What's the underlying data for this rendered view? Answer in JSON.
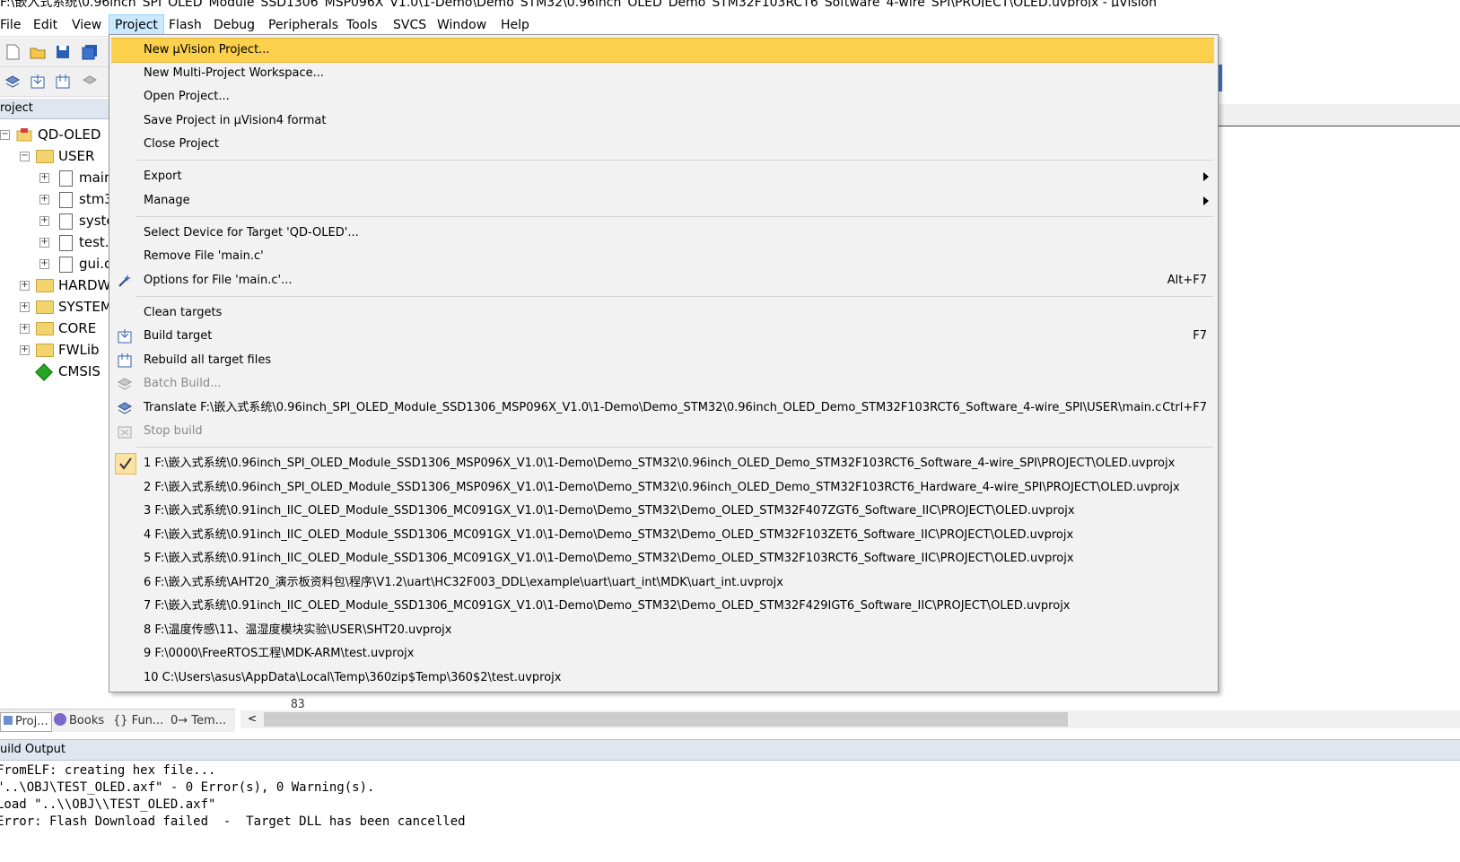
{
  "title": "F:\\嵌入式系统\\0.96inch_SPI_OLED_Module_SSD1306_MSP096X_V1.0\\1-Demo\\Demo_STM32\\0.96inch_OLED_Demo_STM32F103RCT6_Software_4-wire_SPI\\PROJECT\\OLED.uvprojx - µVision",
  "menu": [
    "File",
    "Edit",
    "View",
    "Project",
    "Flash",
    "Debug",
    "Peripherals",
    "Tools",
    "SVCS",
    "Window",
    "Help"
  ],
  "project_pane": {
    "header": "roject",
    "root": "QD-OLED",
    "group_user": "USER",
    "user_files": [
      "main",
      "stm3",
      "syste",
      "test.c",
      "gui.c"
    ],
    "groups": [
      "HARDW",
      "SYSTEM",
      "CORE",
      "FWLib",
      "CMSIS"
    ]
  },
  "dropdown": {
    "new_project": "New µVision Project...",
    "new_workspace": "New Multi-Project Workspace...",
    "open_project": "Open Project...",
    "save_project": "Save Project in µVision4 format",
    "close_project": "Close Project",
    "export": "Export",
    "manage": "Manage",
    "select_device": "Select Device for Target 'QD-OLED'...",
    "remove_file": "Remove File 'main.c'",
    "options_file": "Options for File 'main.c'...",
    "options_shortcut": "Alt+F7",
    "clean_targets": "Clean targets",
    "build_target": "Build target",
    "build_shortcut": "F7",
    "rebuild_all": "Rebuild all target files",
    "batch_build": "Batch Build...",
    "translate": "Translate F:\\嵌入式系统\\0.96inch_SPI_OLED_Module_SSD1306_MSP096X_V1.0\\1-Demo\\Demo_STM32\\0.96inch_OLED_Demo_STM32F103RCT6_Software_4-wire_SPI\\USER\\main.c",
    "translate_shortcut": "Ctrl+F7",
    "stop_build": "Stop build",
    "recent": [
      "1 F:\\嵌入式系统\\0.96inch_SPI_OLED_Module_SSD1306_MSP096X_V1.0\\1-Demo\\Demo_STM32\\0.96inch_OLED_Demo_STM32F103RCT6_Software_4-wire_SPI\\PROJECT\\OLED.uvprojx",
      "2 F:\\嵌入式系统\\0.96inch_SPI_OLED_Module_SSD1306_MSP096X_V1.0\\1-Demo\\Demo_STM32\\0.96inch_OLED_Demo_STM32F103RCT6_Hardware_4-wire_SPI\\PROJECT\\OLED.uvprojx",
      "3 F:\\嵌入式系统\\0.91inch_IIC_OLED_Module_SSD1306_MC091GX_V1.0\\1-Demo\\Demo_STM32\\Demo_OLED_STM32F407ZGT6_Software_IIC\\PROJECT\\OLED.uvprojx",
      "4 F:\\嵌入式系统\\0.91inch_IIC_OLED_Module_SSD1306_MC091GX_V1.0\\1-Demo\\Demo_STM32\\Demo_OLED_STM32F103ZET6_Software_IIC\\PROJECT\\OLED.uvprojx",
      "5 F:\\嵌入式系统\\0.91inch_IIC_OLED_Module_SSD1306_MC091GX_V1.0\\1-Demo\\Demo_STM32\\Demo_OLED_STM32F103RCT6_Software_IIC\\PROJECT\\OLED.uvprojx",
      "6 F:\\嵌入式系统\\AHT20_演示板资料包\\程序\\V1.2\\uart\\HC32F003_DDL\\example\\uart\\uart_int\\MDK\\uart_int.uvprojx",
      "7 F:\\嵌入式系统\\0.91inch_IIC_OLED_Module_SSD1306_MC091GX_V1.0\\1-Demo\\Demo_STM32\\Demo_OLED_STM32F429IGT6_Software_IIC\\PROJECT\\OLED.uvprojx",
      "8 F:\\温度传感\\11、温湿度模块实验\\USER\\SHT20.uvprojx",
      "9 F:\\0000\\FreeRTOS工程\\MDK-ARM\\test.uvprojx",
      "10 C:\\Users\\asus\\AppData\\Local\\Temp\\360zip$Temp\\360$2\\test.uvprojx"
    ]
  },
  "bottom_tabs": [
    "Proj...",
    "Books",
    "{} Fun...",
    "0→ Tem..."
  ],
  "editor_line": "83",
  "build_output": {
    "header": "uild Output",
    "lines": [
      "FromELF: creating hex file...",
      "\"..\\OBJ\\TEST_OLED.axf\" - 0 Error(s), 0 Warning(s).",
      "Load \"..\\\\OBJ\\\\TEST_OLED.axf\"",
      "Error: Flash Download failed  -  Target DLL has been cancelled"
    ]
  },
  "colors": {
    "highlight": "#fbd04c",
    "menu_active": "#cce8ff",
    "pane_header": "#dfe6ef"
  }
}
